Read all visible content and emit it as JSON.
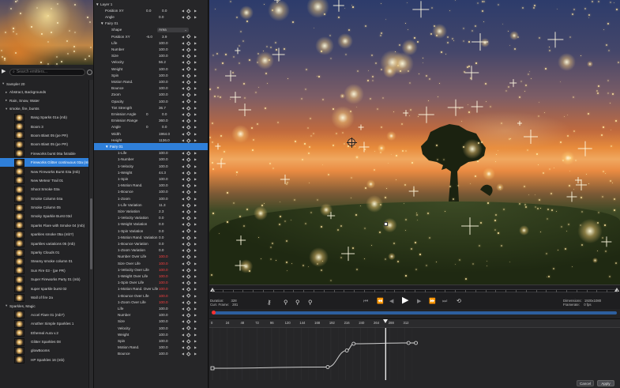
{
  "browser": {
    "search_placeholder": "Search emitters...",
    "groups": [
      {
        "label": "Sampler 20",
        "indent": 0
      },
      {
        "label": "Abstract, Backgrounds",
        "indent": 1
      },
      {
        "label": "Rain, Snow, Water",
        "indent": 1
      },
      {
        "label": "smoke, fire, bursts",
        "indent": 1
      }
    ],
    "items_a": [
      "Bang Sparks 01a (mb)",
      "Boom 3",
      "Boom Blast 05 (pe PR)",
      "Boom Blast 05 (pe PR)",
      "Fireworks burst 06a fxtrable",
      "Fireworks Glitter continuous 03a (mb)",
      "New Fireworks Burst 03a (mb)",
      "New Meteor Trail 01",
      "Shoot Smoke 03a",
      "Smoke Column 04a",
      "Smoke Column 05",
      "Smoky Sparkle Burst 03d",
      "Sparks Flare with Smoke 04 (mb)",
      "sparkles smoke 05a (mb?)",
      "Sparkles variations 05 (mb)",
      "Sparky Clouds 01",
      "Steamy smoke column 01",
      "Sun Fire 03 - (pe PR)",
      "Super Fireworks Party 01 (mb)",
      "super sparkle burst 02",
      "Wall of fire 2a"
    ],
    "group_magic": "Sparkles, Magic",
    "items_b": [
      "Accel Flare 01 (mb?)",
      "Another Simple Sparkles 1",
      "Ethereal Aura v.2",
      "Glitter Sparkles 08",
      "glowBooms",
      "HP Sparkles 16 (mb)"
    ],
    "selected_index": 5
  },
  "params": {
    "layer_label": "Layer 1",
    "layer_position_label": "Position XY",
    "layer_position_x": "0.0",
    "layer_position_y": "0.0",
    "layer_angle_label": "Angle",
    "layer_angle": "0.0",
    "emitter_label": "Fairy 01",
    "shape_label": "Shape",
    "shape_value": "Area",
    "emitter_position_label": "Position XY",
    "emitter_position_x": "-6.0",
    "emitter_position_y": "3.9",
    "emitter_rows": [
      {
        "label": "Life",
        "value": "100.0"
      },
      {
        "label": "Number",
        "value": "100.0"
      },
      {
        "label": "Size",
        "value": "100.0"
      },
      {
        "label": "Velocity",
        "value": "56.2"
      },
      {
        "label": "Weight",
        "value": "100.0"
      },
      {
        "label": "Spin",
        "value": "100.0"
      },
      {
        "label": "Motion Rand.",
        "value": "100.0"
      },
      {
        "label": "Bounce",
        "value": "100.0"
      },
      {
        "label": "Zoom",
        "value": "100.0"
      },
      {
        "label": "Opacity",
        "value": "100.0"
      },
      {
        "label": "Tint Strength",
        "value": "36.7"
      }
    ],
    "emission_angle_label": "Emission Angle",
    "emission_angle_x": "0",
    "emission_angle_y": "0.0",
    "emission_range_label": "Emission Range",
    "emission_range_value": "360.0",
    "angle2_label": "Angle",
    "angle2_x": "0",
    "angle2_y": "0.0",
    "width_label": "Width",
    "width_value": "1964.0",
    "height_label": "Height",
    "height_value": "1136.0",
    "particle_label": "Fairy 01",
    "particle_rows": [
      {
        "label": "1-Life",
        "value": "100.0",
        "red": false
      },
      {
        "label": "1-Number",
        "value": "100.0",
        "red": false
      },
      {
        "label": "1-Velocity",
        "value": "100.0",
        "red": false
      },
      {
        "label": "1-Weight",
        "value": "44.3",
        "red": false
      },
      {
        "label": "1-Spin",
        "value": "100.0",
        "red": false
      },
      {
        "label": "1-Motion Rand.",
        "value": "100.0",
        "red": false
      },
      {
        "label": "1-Bounce",
        "value": "100.0",
        "red": false
      },
      {
        "label": "1-Zoom",
        "value": "100.0",
        "red": false
      },
      {
        "label": "1-Life Variation",
        "value": "11.3",
        "red": false
      },
      {
        "label": "Size Variation",
        "value": "2.3",
        "red": false
      },
      {
        "label": "1-Velocity Variation",
        "value": "0.0",
        "red": false
      },
      {
        "label": "1-Weight Variation",
        "value": "0.0",
        "red": false
      },
      {
        "label": "1-Spin Variation",
        "value": "0.0",
        "red": false
      },
      {
        "label": "1-Motion Rand. Variation",
        "value": "0.0",
        "red": false
      },
      {
        "label": "1-Bounce Variation",
        "value": "0.0",
        "red": false
      },
      {
        "label": "1-Zoom Variation",
        "value": "0.0",
        "red": false
      },
      {
        "label": "Number Over Life",
        "value": "100.0",
        "red": true
      },
      {
        "label": "Size Over Life",
        "value": "100.0",
        "red": true
      },
      {
        "label": "1-Velocity Over Life",
        "value": "100.0",
        "red": true
      },
      {
        "label": "1-Weight Over Life",
        "value": "100.0",
        "red": true
      },
      {
        "label": "1-Spin Over Life",
        "value": "100.0",
        "red": true
      },
      {
        "label": "1-Motion Rand. Over Life",
        "value": "100.0",
        "red": true
      },
      {
        "label": "1-Bounce Over Life",
        "value": "100.0",
        "red": true
      },
      {
        "label": "1-Zoom Over Life",
        "value": "100.0",
        "red": true
      },
      {
        "label": "Life",
        "value": "100.0",
        "red": false
      },
      {
        "label": "Number",
        "value": "100.0",
        "red": false
      },
      {
        "label": "Size",
        "value": "100.0",
        "red": false
      },
      {
        "label": "Velocity",
        "value": "100.0",
        "red": false
      },
      {
        "label": "Weight",
        "value": "100.0",
        "red": false
      },
      {
        "label": "Spin",
        "value": "100.0",
        "red": false
      },
      {
        "label": "Motion Rand.",
        "value": "100.0",
        "red": false
      },
      {
        "label": "Bounce",
        "value": "100.0",
        "red": false
      }
    ]
  },
  "transport": {
    "duration_label": "Duration:",
    "duration_value": "328",
    "curr_frame_label": "Curr. Frame:",
    "curr_frame_value": "281",
    "dimensions_label": "Dimensions:",
    "dimensions_value": "1920x1080",
    "frame_rate_label": "Framerate:",
    "frame_rate_value": "0 fps"
  },
  "timeline": {
    "ruler_labels": [
      "0",
      "24",
      "48",
      "72",
      "96",
      "120",
      "144",
      "168",
      "192",
      "216",
      "240",
      "264",
      "288",
      "312"
    ],
    "playhead_frame": 281,
    "max_frame": 328,
    "curve_keys": [
      {
        "frame": 0,
        "value": 0.1
      },
      {
        "frame": 187,
        "value": 0.13
      },
      {
        "frame": 218,
        "value": 0.55
      },
      {
        "frame": 229,
        "value": 0.72
      },
      {
        "frame": 318,
        "value": 0.74
      },
      {
        "frame": 330,
        "value": 0.74
      }
    ]
  },
  "buttons": {
    "cancel": "Cancel",
    "apply": "Apply"
  }
}
